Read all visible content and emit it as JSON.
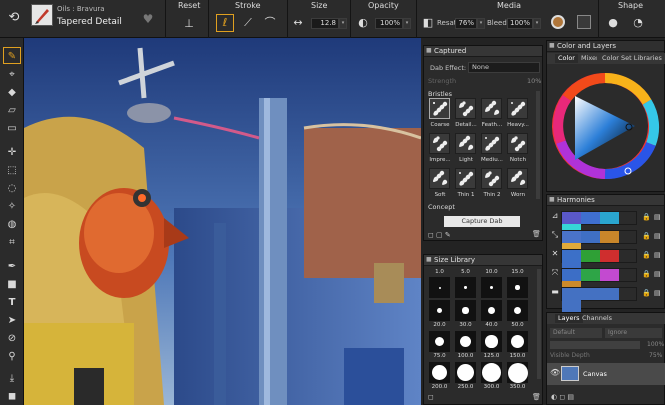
{
  "brush": {
    "category": "Oils : Bravura",
    "variant": "Tapered Detail"
  },
  "toolbar": {
    "reset_label": "Reset",
    "stroke_label": "Stroke",
    "size_label": "Size",
    "size_value": "12.8",
    "opacity_label": "Opacity",
    "opacity_value": "100%",
    "media_label": "Media",
    "resat_label": "Resat:",
    "resat_value": "76%",
    "bleed_label": "Bleed:",
    "bleed_value": "100%",
    "shape_label": "Shape"
  },
  "captured_panel": {
    "title": "Captured",
    "dab_effect_label": "Dab Effect:",
    "dab_effect_value": "None",
    "strength_label": "Strength",
    "strength_value": "10%",
    "group1": "Bristles",
    "dabs": [
      "Coarse",
      "Detail...",
      "Feath...",
      "Heavy...",
      "Impre...",
      "Light",
      "Mediu...",
      "Notch",
      "Soft",
      "Thin 1",
      "Thin 2",
      "Worn"
    ],
    "group2": "Concept",
    "capture_button": "Capture Dab"
  },
  "size_library": {
    "title": "Size Library",
    "sizes": [
      "1.0",
      "5.0",
      "10.0",
      "15.0",
      "20.0",
      "30.0",
      "40.0",
      "50.0",
      "75.0",
      "100.0",
      "125.0",
      "150.0",
      "200.0",
      "250.0",
      "300.0",
      "350.0"
    ]
  },
  "color_panel": {
    "title": "Color and Layers",
    "tabs": [
      "Color",
      "Mixer",
      "Color Set Libraries"
    ]
  },
  "harmonies": {
    "title": "Harmonies",
    "rows": [
      [
        "#5a58c8",
        "#3f6fd0",
        "#2aa6cf",
        "#36d6d6"
      ],
      [
        "#4a73c9",
        "#3f6fc4",
        "#c8862a",
        "#e1aa3b"
      ],
      [
        "#3c70c8",
        "#2fa036",
        "#cf2e2e",
        "#3d6fc8"
      ],
      [
        "#3c6ec6",
        "#2ea547",
        "#c34ad0",
        "#cc8a2a"
      ],
      [
        "#4471c2",
        "#4471c2",
        "#4471c2",
        "#4471c2"
      ]
    ]
  },
  "layers": {
    "tabs": [
      "Layers",
      "Channels"
    ],
    "composite_method": "Default",
    "composite_depth": "Ignore",
    "opacity_value": "100%",
    "visible_depth_label": "Visible Depth",
    "visible_depth_value": "75%",
    "canvas_layer": "Canvas"
  }
}
